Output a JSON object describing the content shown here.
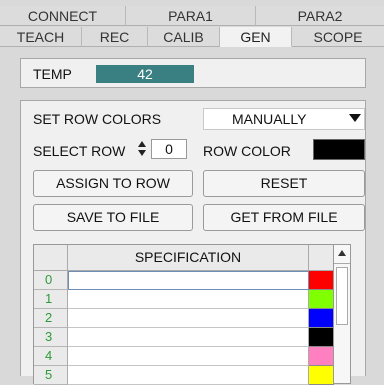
{
  "tabs_top": [
    {
      "label": "CONNECT",
      "w": 126
    },
    {
      "label": "PARA1",
      "w": 130
    },
    {
      "label": "PARA2",
      "w": 128
    }
  ],
  "tabs_bottom": [
    {
      "label": "TEACH",
      "w": 68,
      "active": false
    },
    {
      "label": "REC",
      "w": 64,
      "active": false
    },
    {
      "label": "CALIB",
      "w": 72,
      "active": false
    },
    {
      "label": "GEN",
      "w": 62,
      "active": true
    },
    {
      "label": "SCOPE",
      "w": 73,
      "active": false
    }
  ],
  "temp": {
    "label": "TEMP",
    "value": "42"
  },
  "row_colors": {
    "label": "SET ROW COLORS",
    "mode": "MANUALLY"
  },
  "select_row": {
    "label": "SELECT ROW",
    "value": "0",
    "color_label": "ROW COLOR",
    "color": "#000000"
  },
  "buttons": {
    "assign": "ASSIGN TO ROW",
    "reset": "RESET",
    "save": "SAVE TO FILE",
    "get": "GET FROM FILE"
  },
  "table": {
    "header": "SPECIFICATION",
    "rows": [
      {
        "index": "0",
        "color": "#ff0000"
      },
      {
        "index": "1",
        "color": "#80ff00"
      },
      {
        "index": "2",
        "color": "#0000ff"
      },
      {
        "index": "3",
        "color": "#000000"
      },
      {
        "index": "4",
        "color": "#ff80c0"
      },
      {
        "index": "5",
        "color": "#ffff00"
      }
    ]
  }
}
